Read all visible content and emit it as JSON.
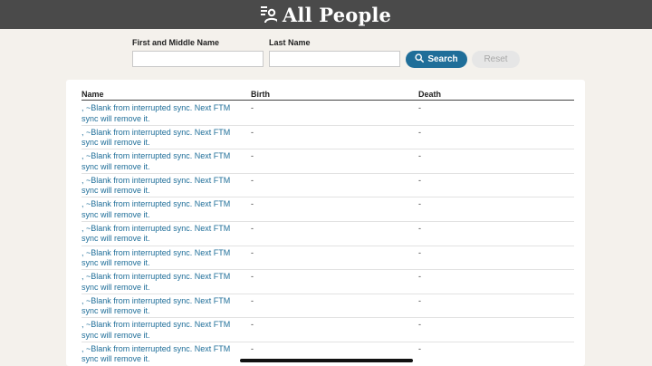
{
  "header": {
    "title": "All People",
    "icon": "people-list-icon"
  },
  "search": {
    "first_middle_label": "First and Middle Name",
    "first_middle_value": "",
    "last_label": "Last Name",
    "last_value": "",
    "search_label": "Search",
    "reset_label": "Reset"
  },
  "table": {
    "columns": [
      "Name",
      "Birth",
      "Death"
    ],
    "rows": [
      {
        "name": ", ~Blank from interrupted sync. Next FTM sync will remove it.",
        "birth": "-",
        "death": "-"
      },
      {
        "name": ", ~Blank from interrupted sync. Next FTM sync will remove it.",
        "birth": "-",
        "death": "-"
      },
      {
        "name": ", ~Blank from interrupted sync. Next FTM sync will remove it.",
        "birth": "-",
        "death": "-"
      },
      {
        "name": ", ~Blank from interrupted sync. Next FTM sync will remove it.",
        "birth": "-",
        "death": "-"
      },
      {
        "name": ", ~Blank from interrupted sync. Next FTM sync will remove it.",
        "birth": "-",
        "death": "-"
      },
      {
        "name": ", ~Blank from interrupted sync. Next FTM sync will remove it.",
        "birth": "-",
        "death": "-"
      },
      {
        "name": ", ~Blank from interrupted sync. Next FTM sync will remove it.",
        "birth": "-",
        "death": "-"
      },
      {
        "name": ", ~Blank from interrupted sync. Next FTM sync will remove it.",
        "birth": "-",
        "death": "-"
      },
      {
        "name": ", ~Blank from interrupted sync. Next FTM sync will remove it.",
        "birth": "-",
        "death": "-"
      },
      {
        "name": ", ~Blank from interrupted sync. Next FTM sync will remove it.",
        "birth": "-",
        "death": "-"
      },
      {
        "name": ", ~Blank from interrupted sync. Next FTM sync will remove it.",
        "birth": "-",
        "death": "-"
      }
    ]
  },
  "colors": {
    "header_bg": "#4a4a4a",
    "accent": "#1f6e99",
    "page_bg": "#f4f1ec"
  }
}
